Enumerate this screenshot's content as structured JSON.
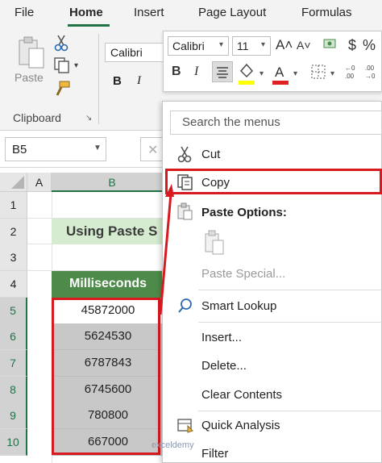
{
  "ribbon": {
    "tabs": [
      "File",
      "Home",
      "Insert",
      "Page Layout",
      "Formulas"
    ],
    "paste_label": "Paste",
    "clipboard_label": "Clipboard",
    "font_name": "Calibri",
    "bold_label": "B",
    "italic_label": "I"
  },
  "mini_toolbar": {
    "font": "Calibri",
    "size": "11",
    "increase_font": "A˄",
    "decrease_font": "A˅",
    "currency": "$",
    "percent": "%",
    "bold": "B",
    "italic": "I",
    "fill_color": "#ffff00",
    "font_color": "#e02020"
  },
  "formula_bar": {
    "name_box": "B5",
    "cancel_symbol": "✕"
  },
  "grid": {
    "columns": [
      "A",
      "B"
    ],
    "rows": [
      "1",
      "2",
      "3",
      "4",
      "5",
      "6",
      "7",
      "8",
      "9",
      "10"
    ],
    "title": "Using Paste S",
    "header": "Milliseconds",
    "values": [
      "45872000",
      "5624530",
      "6787843",
      "6745600",
      "780800",
      "667000"
    ]
  },
  "context_menu": {
    "search_placeholder": "Search the menus",
    "items": {
      "cut": "Cut",
      "copy": "Copy",
      "paste_options": "Paste Options:",
      "paste_special": "Paste Special...",
      "smart_lookup": "Smart Lookup",
      "insert": "Insert...",
      "delete": "Delete...",
      "clear_contents": "Clear Contents",
      "quick_analysis": "Quick Analysis",
      "filter": "Filter"
    }
  },
  "watermark": "exceldemy",
  "colors": {
    "accent_green": "#217346",
    "highlight_red": "#d71920",
    "header_green": "#4e8a4a",
    "title_fill": "#d6ecd0"
  }
}
